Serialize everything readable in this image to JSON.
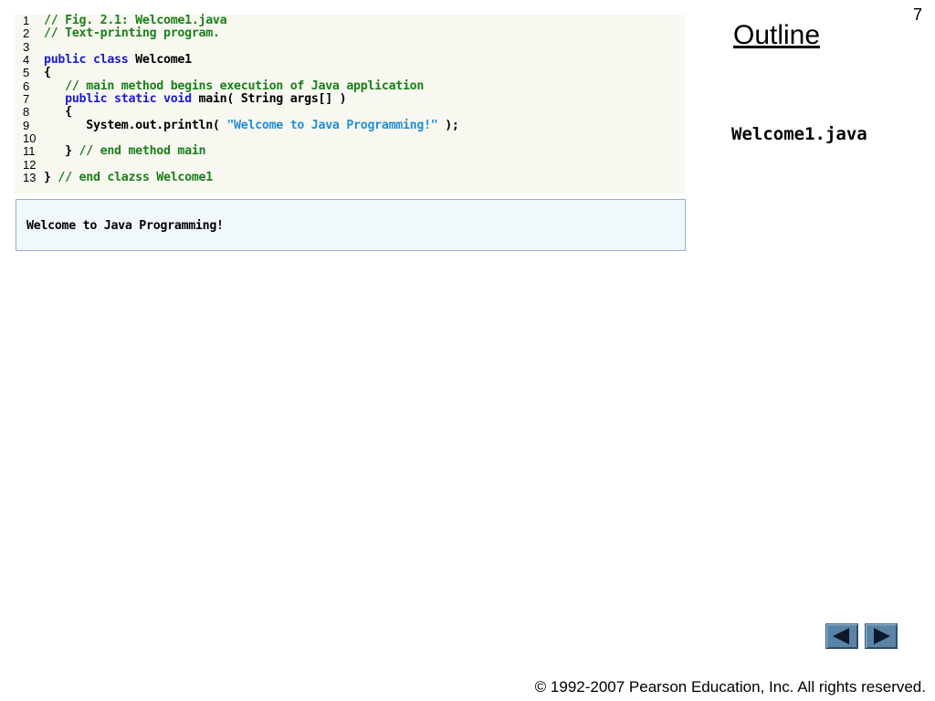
{
  "slide": {
    "number": "7",
    "outline_title": "Outline",
    "file_label": "Welcome1.java"
  },
  "code": {
    "lines": [
      {
        "n": "1",
        "segs": [
          {
            "t": "// Fig. 2.1: Welcome1.java",
            "c": "cm"
          }
        ]
      },
      {
        "n": "2",
        "segs": [
          {
            "t": "// Text-printing program.",
            "c": "cm"
          }
        ]
      },
      {
        "n": "3",
        "segs": []
      },
      {
        "n": "4",
        "segs": [
          {
            "t": "public class ",
            "c": "kw"
          },
          {
            "t": "Welcome1",
            "c": "pl"
          }
        ]
      },
      {
        "n": "5",
        "segs": [
          {
            "t": "{",
            "c": "pl"
          }
        ]
      },
      {
        "n": "6",
        "segs": [
          {
            "t": "   // main method begins execution of Java application",
            "c": "cm"
          }
        ]
      },
      {
        "n": "7",
        "segs": [
          {
            "t": "   public static void ",
            "c": "kw"
          },
          {
            "t": "main( String args[] )",
            "c": "pl"
          }
        ]
      },
      {
        "n": "8",
        "segs": [
          {
            "t": "   {",
            "c": "pl"
          }
        ]
      },
      {
        "n": "9",
        "segs": [
          {
            "t": "      System.out.println( ",
            "c": "pl"
          },
          {
            "t": "\"Welcome to Java Programming!\"",
            "c": "st"
          },
          {
            "t": " );",
            "c": "pl"
          }
        ]
      },
      {
        "n": "10",
        "segs": []
      },
      {
        "n": "11",
        "segs": [
          {
            "t": "   } ",
            "c": "pl"
          },
          {
            "t": "// end method main",
            "c": "cm"
          }
        ]
      },
      {
        "n": "12",
        "segs": []
      },
      {
        "n": "13",
        "segs": [
          {
            "t": "} ",
            "c": "pl"
          },
          {
            "t": "// end clazss Welcome1",
            "c": "cm"
          }
        ]
      }
    ]
  },
  "output": {
    "text": "Welcome to Java Programming!"
  },
  "navigation": {
    "prev_icon": "triangle-left-icon",
    "next_icon": "triangle-right-icon"
  },
  "footer": {
    "copyright": "© 1992-2007 Pearson Education, Inc.  All rights reserved."
  },
  "colors": {
    "comment": "#1a7f1a",
    "keyword": "#1a1ad0",
    "string": "#1f8fd8",
    "nav_button": "#5a84a6"
  }
}
